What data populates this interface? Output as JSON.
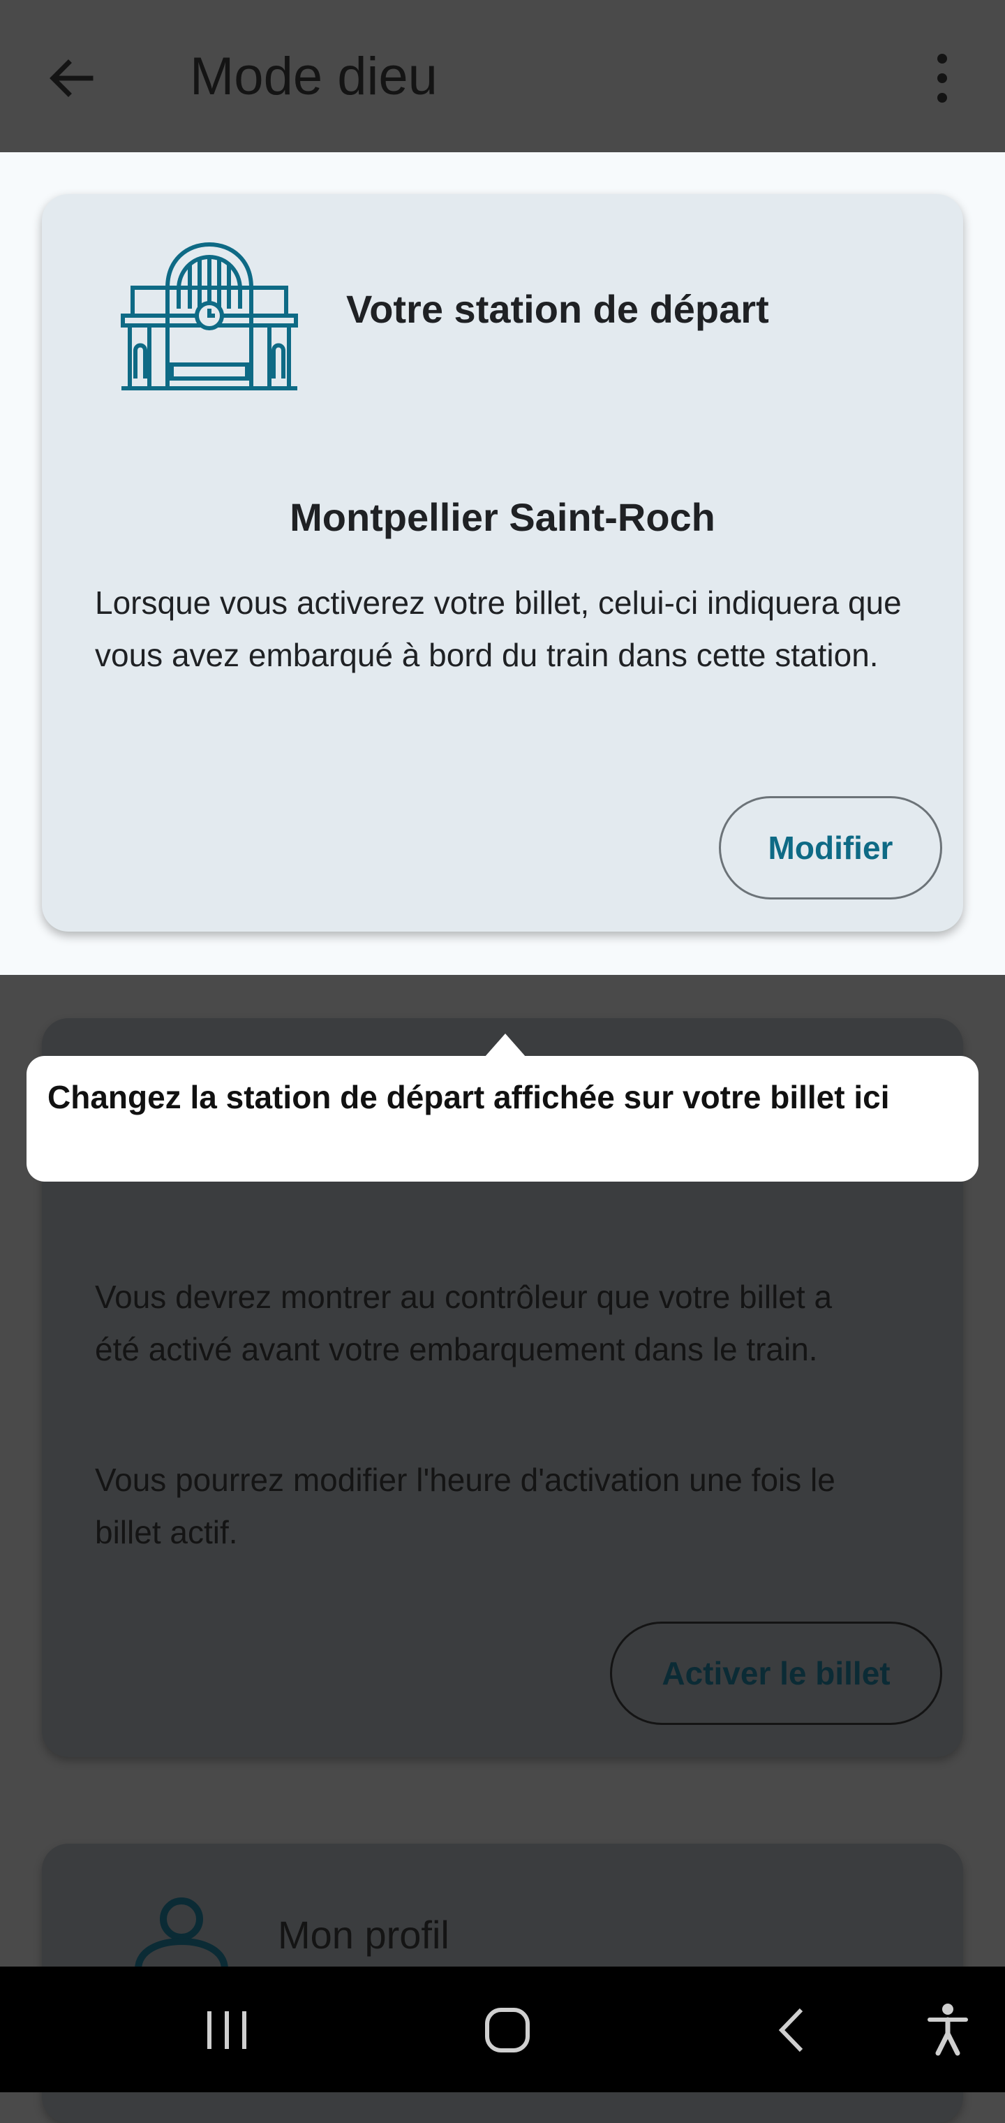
{
  "app_bar": {
    "title": "Mode dieu",
    "back_icon": "arrow-left-icon",
    "menu_icon": "more-vert-icon"
  },
  "station_card": {
    "icon": "train-station-icon",
    "title": "Votre station de départ",
    "station": "Montpellier Saint-Roch",
    "description": "Lorsque vous activerez votre billet, celui-ci indiquera que vous avez embarqué à bord du train dans cette station.",
    "modify_label": "Modifier"
  },
  "tooltip": {
    "text": "Changez la station de départ affichée sur votre billet ici"
  },
  "activation_card": {
    "paragraph1": "Vous devrez montrer au contrôleur que votre billet a été activé avant votre embarquement dans le train.",
    "paragraph2": "Vous pourrez modifier l'heure d'activation une fois le billet actif.",
    "activate_label": "Activer le billet"
  },
  "profile_card": {
    "icon": "person-icon",
    "label": "Mon profil"
  },
  "nav_bar": {
    "recents_icon": "recent-apps-icon",
    "home_icon": "home-icon",
    "back_icon": "back-chevron-icon",
    "accessibility_icon": "accessibility-icon"
  },
  "colors": {
    "accent": "#0e6a85",
    "scrim": "#4a4a4a",
    "card_background": "#e3eaef"
  }
}
